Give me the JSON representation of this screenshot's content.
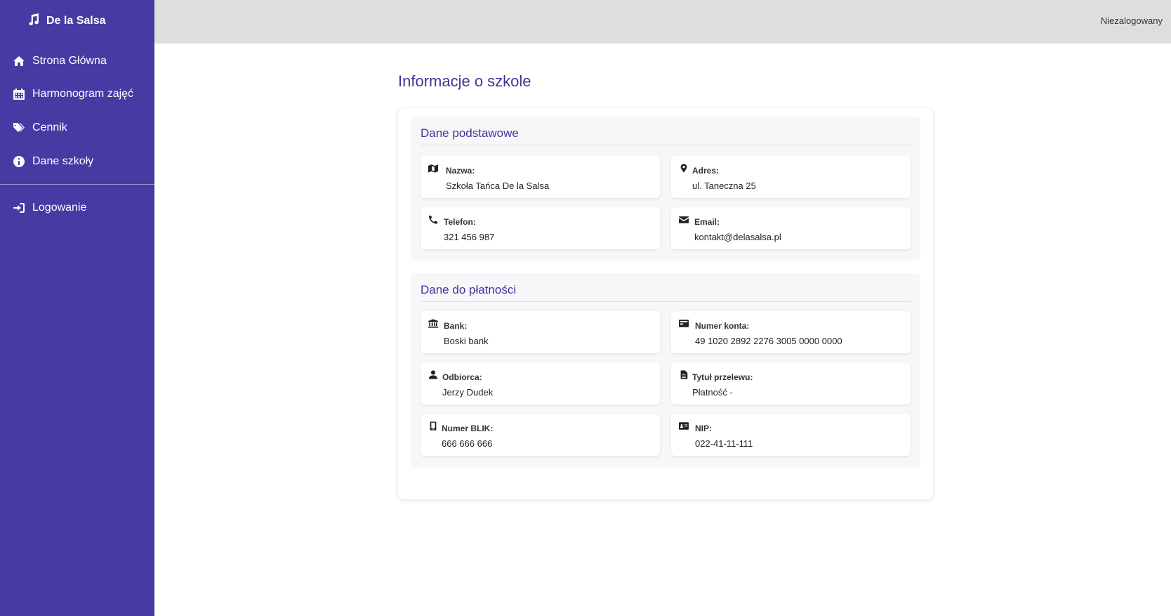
{
  "sidebar": {
    "brand": "De la Salsa",
    "items": [
      {
        "label": "Strona Główna",
        "icon": "home-icon"
      },
      {
        "label": "Harmonogram zajęć",
        "icon": "calendar-icon"
      },
      {
        "label": "Cennik",
        "icon": "tags-icon"
      },
      {
        "label": "Dane szkoły",
        "icon": "info-circle-icon"
      },
      {
        "label": "Logowanie",
        "icon": "sign-in-icon"
      }
    ]
  },
  "topbar": {
    "status": "Niezalogowany"
  },
  "main": {
    "title": "Informacje o szkole",
    "basic": {
      "title": "Dane podstawowe",
      "fields": [
        {
          "label": "Nazwa:",
          "value": "Szkoła Tańca De la Salsa",
          "icon": "map-icon"
        },
        {
          "label": "Adres:",
          "value": "ul. Taneczna 25",
          "icon": "map-marker-icon"
        },
        {
          "label": "Telefon:",
          "value": "321 456 987",
          "icon": "phone-icon"
        },
        {
          "label": "Email:",
          "value": "kontakt@delasalsa.pl",
          "icon": "envelope-icon"
        }
      ]
    },
    "payment": {
      "title": "Dane do płatności",
      "fields": [
        {
          "label": "Bank:",
          "value": "Boski bank",
          "icon": "bank-icon"
        },
        {
          "label": "Numer konta:",
          "value": "49 1020 2892 2276 3005 0000 0000",
          "icon": "credit-card-icon"
        },
        {
          "label": "Odbiorca:",
          "value": "Jerzy Dudek",
          "icon": "user-icon"
        },
        {
          "label": "Tytuł przelewu:",
          "value": "Płatność -",
          "icon": "document-icon"
        },
        {
          "label": "Numer BLIK:",
          "value": "666 666 666",
          "icon": "mobile-icon"
        },
        {
          "label": "NIP:",
          "value": "022-41-11-111",
          "icon": "id-card-icon"
        }
      ]
    }
  }
}
